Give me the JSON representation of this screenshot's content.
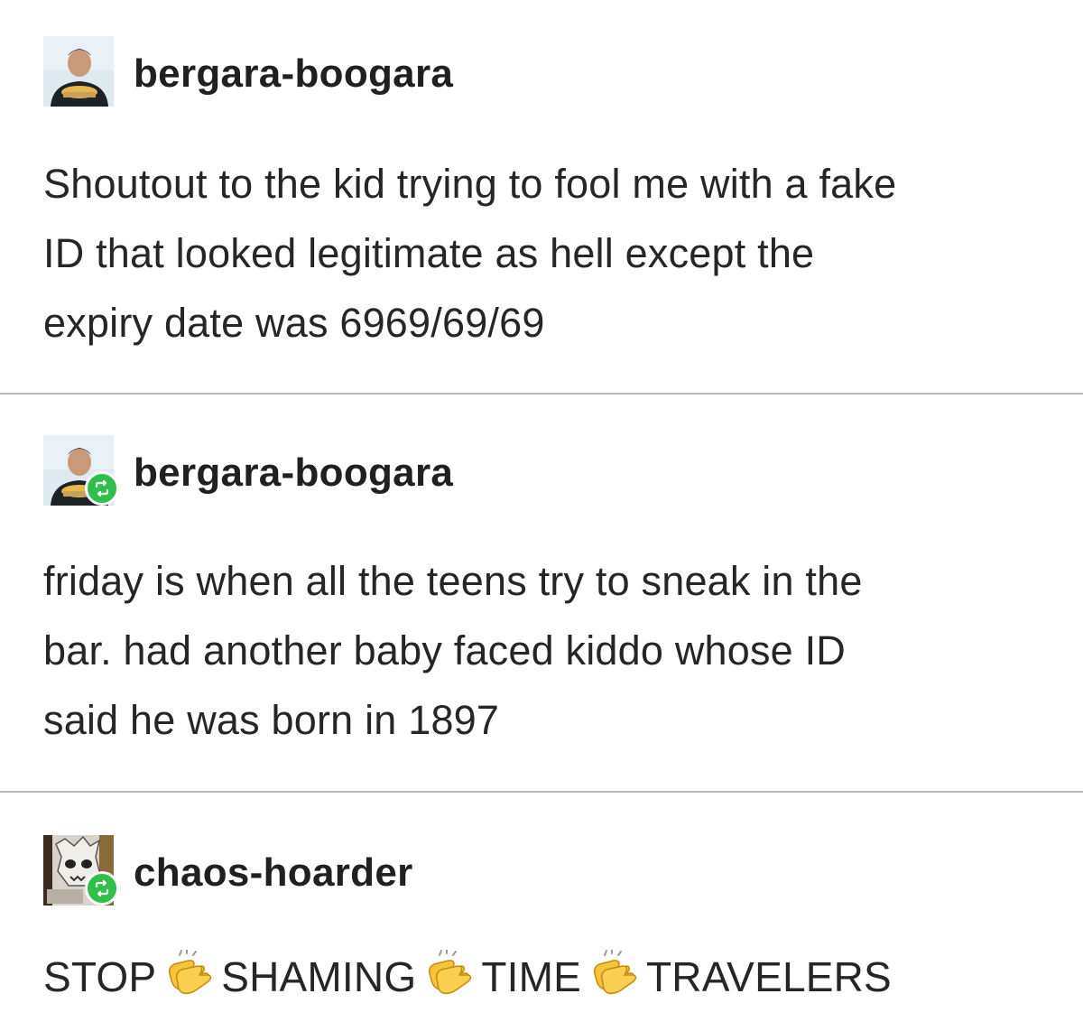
{
  "posts": [
    {
      "username": "bergara-boogara",
      "avatar_icon": "profile-photo-man-icon",
      "is_reblog": false,
      "lines": [
        "Shoutout to the kid trying to fool me with a fake",
        "ID that looked legitimate as hell except the",
        "expiry date was 6969/69/69"
      ]
    },
    {
      "username": "bergara-boogara",
      "avatar_icon": "profile-photo-man-icon",
      "is_reblog": true,
      "reblog_icon": "reblog-icon",
      "lines": [
        "friday is when all the teens try to sneak in the",
        "bar. had another baby faced kiddo whose ID",
        "said he was born in 1897"
      ]
    },
    {
      "username": "chaos-hoarder",
      "avatar_icon": "skull-character-icon",
      "is_reblog": true,
      "reblog_icon": "reblog-icon",
      "words": [
        "STOP",
        "SHAMING",
        "TIME",
        "TRAVELERS"
      ],
      "separator_icon": "clapping-hands-emoji"
    }
  ],
  "colors": {
    "reblog_badge": "#2ec04a",
    "divider": "#b9b9b9",
    "text": "#262626",
    "clap_emoji": "#f5c43a"
  }
}
